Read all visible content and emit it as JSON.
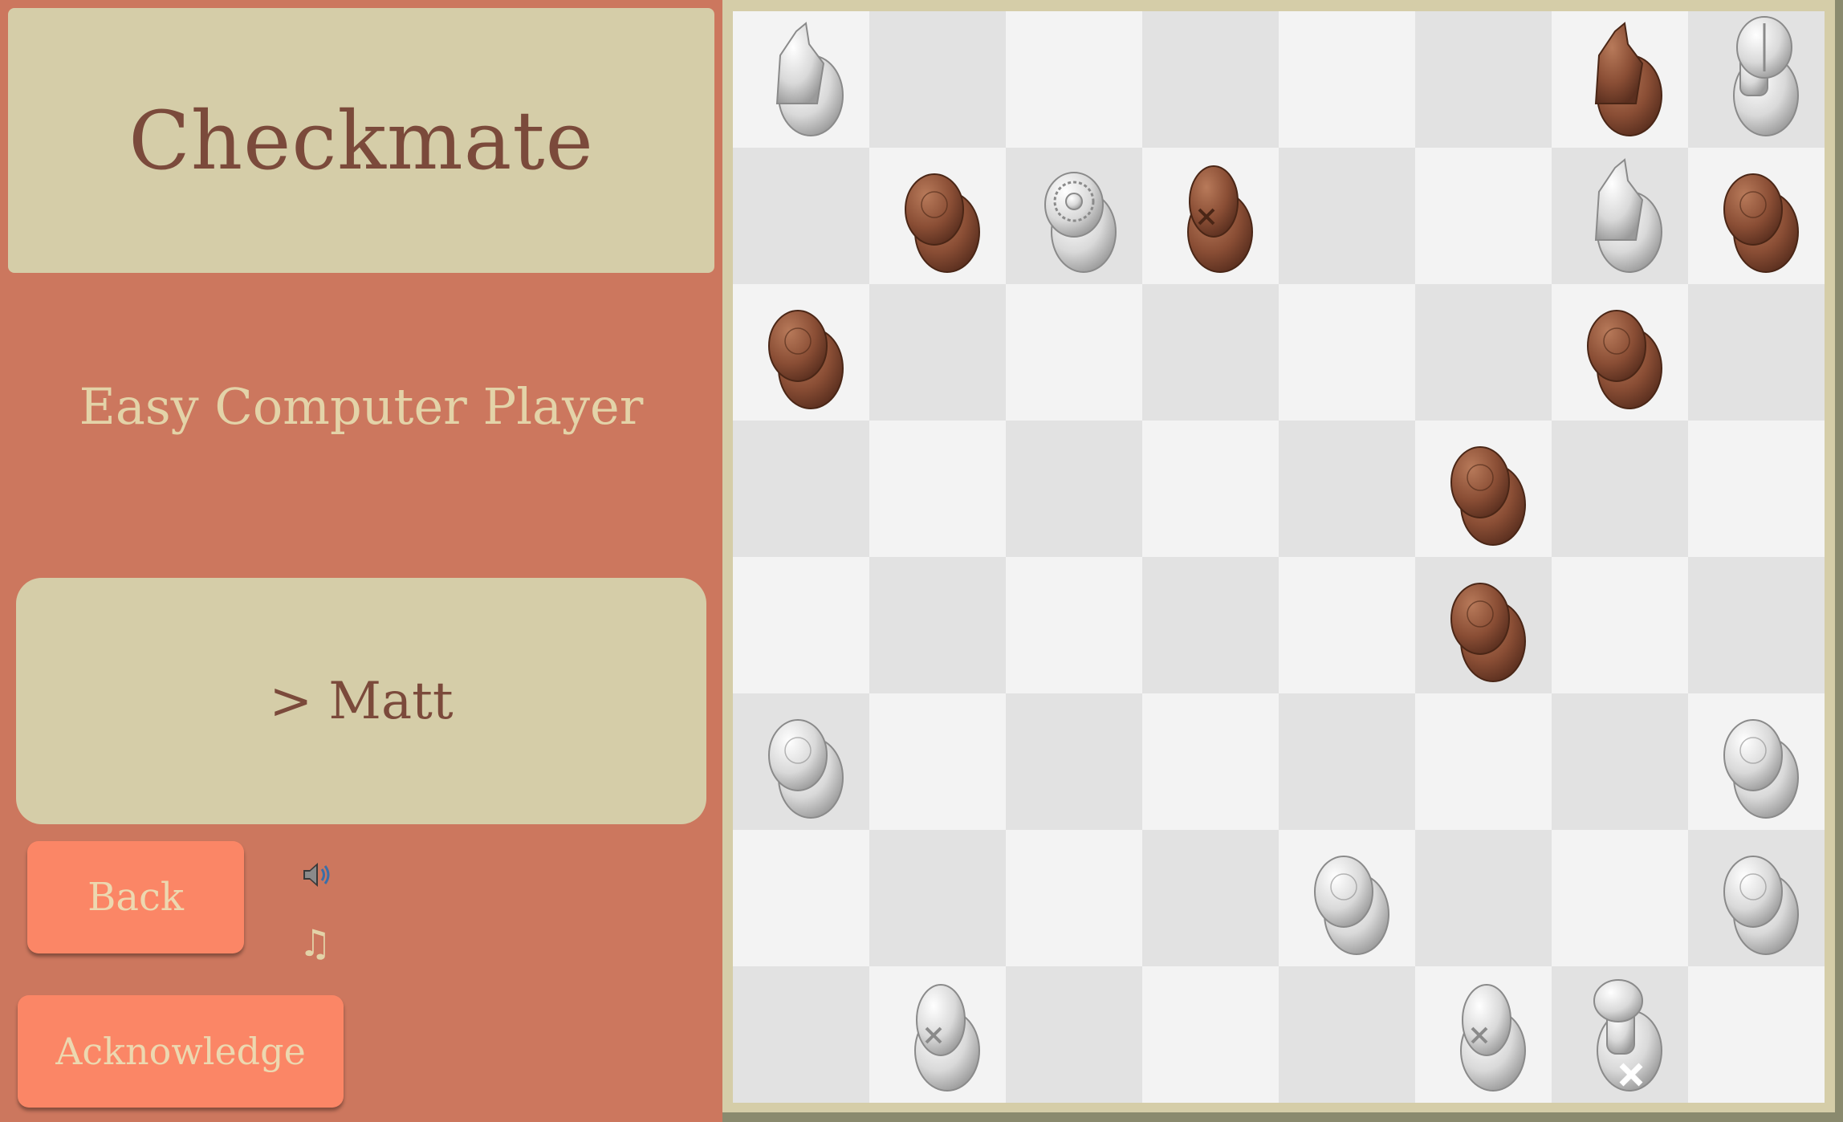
{
  "title": "Checkmate",
  "opponent_label": "Easy Computer Player",
  "player_label": "> Matt",
  "buttons": {
    "back": "Back",
    "acknowledge": "Acknowledge"
  },
  "icons": {
    "sound": "speaker-icon",
    "music": "music-note-icon",
    "music_glyph": "♫"
  },
  "colors": {
    "background": "#cc775e",
    "panel": "#d5cda8",
    "button": "#fb8666",
    "light_square": "#f3f3f3",
    "dark_square": "#e2e2e2",
    "white_piece": "#dedede",
    "black_piece": "#8a4e35"
  },
  "board": {
    "orientation": "black-at-top",
    "pieces": [
      {
        "square": "a8",
        "color": "white",
        "type": "knight"
      },
      {
        "square": "g8",
        "color": "black",
        "type": "knight"
      },
      {
        "square": "h8",
        "color": "white",
        "type": "rook"
      },
      {
        "square": "b7",
        "color": "black",
        "type": "pawn"
      },
      {
        "square": "c7",
        "color": "white",
        "type": "queen"
      },
      {
        "square": "d7",
        "color": "black",
        "type": "bishop"
      },
      {
        "square": "g7",
        "color": "white",
        "type": "knight"
      },
      {
        "square": "h7",
        "color": "black",
        "type": "pawn"
      },
      {
        "square": "a6",
        "color": "black",
        "type": "pawn"
      },
      {
        "square": "g6",
        "color": "black",
        "type": "pawn"
      },
      {
        "square": "f5",
        "color": "black",
        "type": "pawn"
      },
      {
        "square": "f4",
        "color": "black",
        "type": "pawn"
      },
      {
        "square": "a3",
        "color": "white",
        "type": "pawn"
      },
      {
        "square": "h3",
        "color": "white",
        "type": "pawn"
      },
      {
        "square": "e2",
        "color": "white",
        "type": "pawn"
      },
      {
        "square": "h2",
        "color": "white",
        "type": "pawn"
      },
      {
        "square": "b1",
        "color": "white",
        "type": "bishop"
      },
      {
        "square": "f1",
        "color": "white",
        "type": "bishop"
      },
      {
        "square": "g1",
        "color": "white",
        "type": "king"
      }
    ]
  }
}
